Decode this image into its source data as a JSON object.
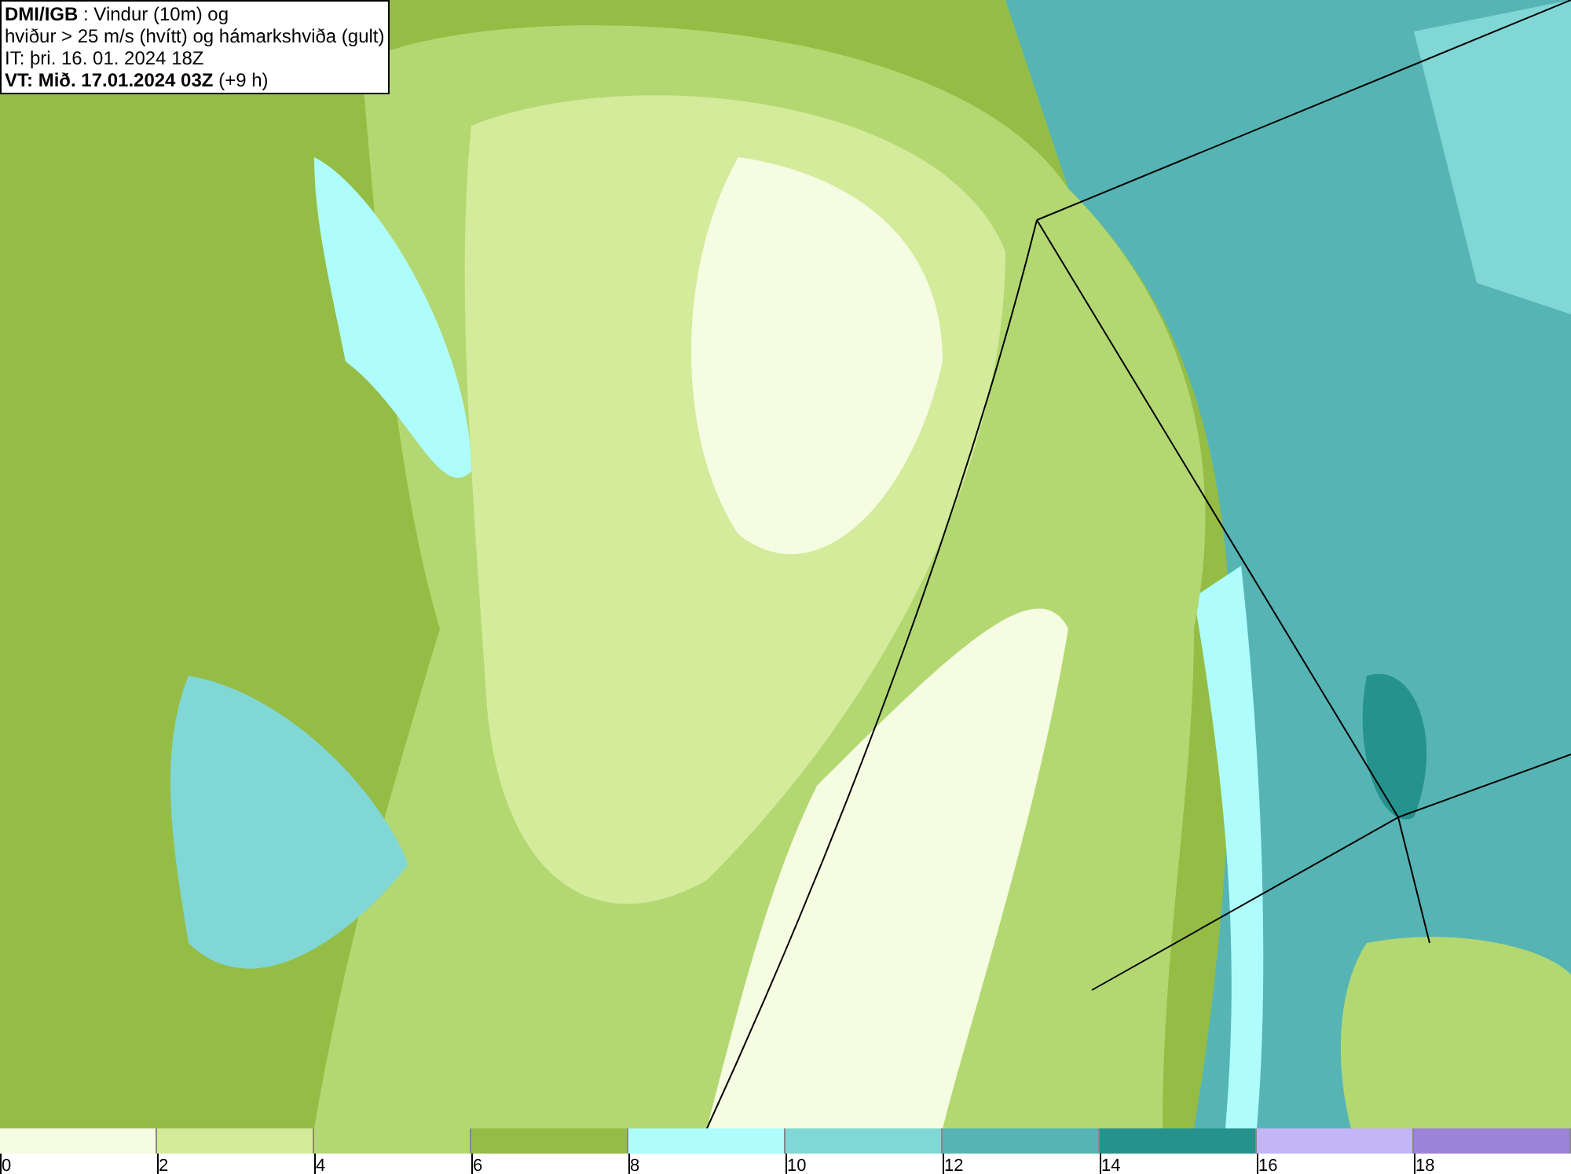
{
  "info_box": {
    "lines": [
      "**DMI/IGB** : Vindur (10m) og",
      "hviður > 25 m/s (hvítt) og hámarkshviða (gult)",
      "IT: þri. 16. 01. 2024 18Z",
      "**VT: Mið. 17.01.2024 03Z** (+9 h)"
    ]
  },
  "color_scale": [
    {
      "label": "0",
      "color": "#f5fce1"
    },
    {
      "label": "2",
      "color": "#d3eb9a"
    },
    {
      "label": "4",
      "color": "#b3d872"
    },
    {
      "label": "6",
      "color": "#95bd45"
    },
    {
      "label": "8",
      "color": "#aefcfc"
    },
    {
      "label": "10",
      "color": "#80d7d6"
    },
    {
      "label": "12",
      "color": "#56b5b4"
    },
    {
      "label": "14",
      "color": "#25928e"
    },
    {
      "label": "16",
      "color": "#c4b5f7"
    },
    {
      "label": "18",
      "color": "#9c82d8"
    }
  ]
}
